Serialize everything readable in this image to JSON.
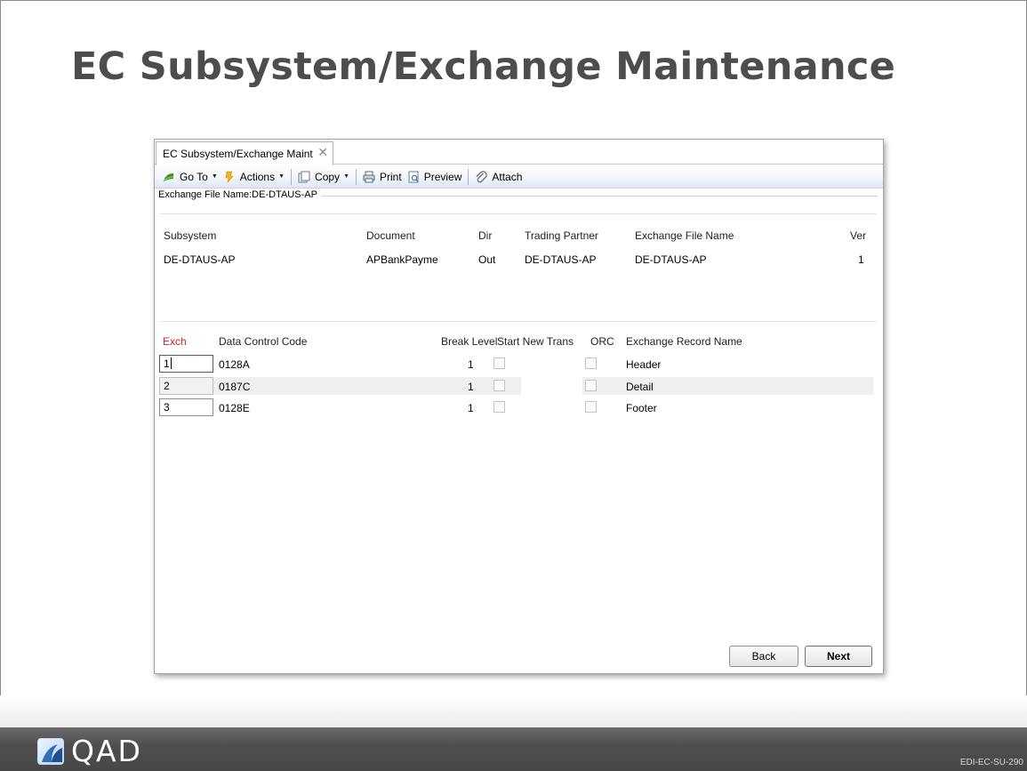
{
  "slide": {
    "title": "EC Subsystem/Exchange Maintenance",
    "logo_text": "QAD",
    "slide_code": "EDI-EC-SU-290"
  },
  "window": {
    "tab_label": "EC Subsystem/Exchange Maint",
    "tab_close": "✕",
    "toolbar": {
      "goto": "Go To",
      "actions": "Actions",
      "copy": "Copy",
      "print": "Print",
      "preview": "Preview",
      "attach": "Attach"
    },
    "section_label": "Exchange File Name:DE-DTAUS-AP",
    "summary": {
      "headers": {
        "subsystem": "Subsystem",
        "document": "Document",
        "dir": "Dir",
        "trading_partner": "Trading Partner",
        "exchange_file_name": "Exchange File Name",
        "ver": "Ver"
      },
      "row": {
        "subsystem": "DE-DTAUS-AP",
        "document": "APBankPayme",
        "dir": "Out",
        "trading_partner": "DE-DTAUS-AP",
        "exchange_file_name": "DE-DTAUS-AP",
        "ver": "1"
      }
    },
    "grid": {
      "headers": {
        "exch": "Exch",
        "data_control_code": "Data Control Code",
        "break_level": "Break Level",
        "start_new_trans": "Start New Trans",
        "orc": "ORC",
        "exchange_record_name": "Exchange Record Name"
      },
      "rows": [
        {
          "exch": "1",
          "data_control_code": "0128A",
          "break_level": "1",
          "start_new_trans": false,
          "orc": false,
          "exchange_record_name": "Header"
        },
        {
          "exch": "2",
          "data_control_code": "0187C",
          "break_level": "1",
          "start_new_trans": false,
          "orc": false,
          "exchange_record_name": "Detail"
        },
        {
          "exch": "3",
          "data_control_code": "0128E",
          "break_level": "1",
          "start_new_trans": false,
          "orc": false,
          "exchange_record_name": "Footer"
        }
      ]
    },
    "buttons": {
      "back": "Back",
      "next": "Next"
    }
  },
  "colors": {
    "title_text": "#4d4d4d",
    "required_label": "#d2202a",
    "footer_bar": "#4f4f4f",
    "toolbar_gradient_end": "#dfe7f3"
  },
  "icons": [
    "goto-icon",
    "actions-icon",
    "copy-icon",
    "print-icon",
    "preview-icon",
    "attach-icon",
    "close-icon",
    "qad-logo-icon"
  ]
}
